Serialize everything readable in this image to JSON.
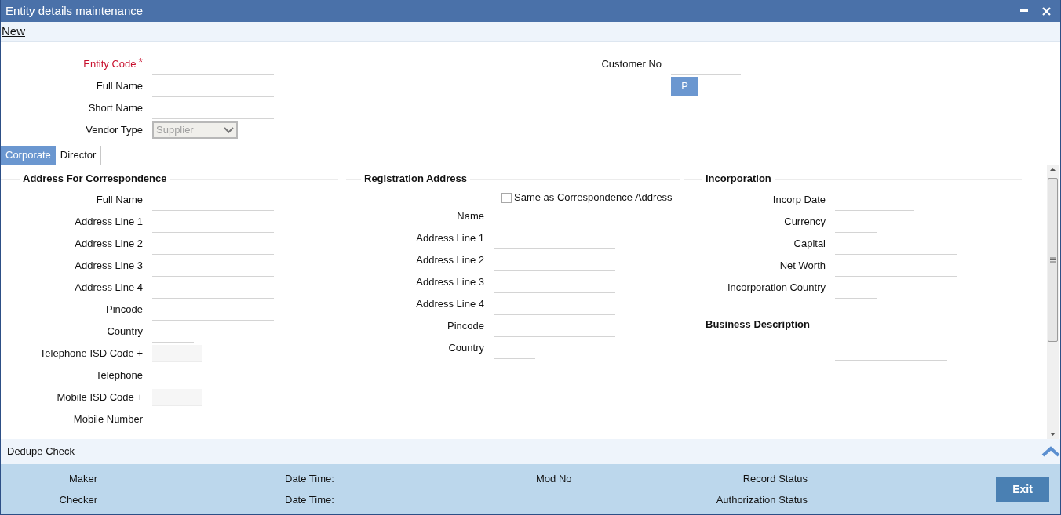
{
  "window": {
    "title": "Entity details maintenance"
  },
  "toolbar": {
    "link": "New"
  },
  "header_fields": [
    {
      "label": "Entity Code",
      "required": true,
      "required_mark": "*",
      "kind": "text"
    },
    {
      "label": "Full Name",
      "required": false,
      "kind": "text"
    },
    {
      "label": "Short Name",
      "required": false,
      "kind": "text"
    },
    {
      "label": "Vendor Type",
      "required": false,
      "kind": "select",
      "value": "Supplier",
      "disabled": true
    }
  ],
  "customer": {
    "label": "Customer No",
    "button": "P"
  },
  "tabs": [
    {
      "label": "Corporate",
      "selected": true
    },
    {
      "label": "Director",
      "selected": false
    }
  ],
  "correspondence": {
    "title": "Address For Correspondence",
    "fields": [
      {
        "label": "Full Name",
        "kind": "text"
      },
      {
        "label": "Address Line 1",
        "kind": "text"
      },
      {
        "label": "Address Line 2",
        "kind": "text"
      },
      {
        "label": "Address Line 3",
        "kind": "text"
      },
      {
        "label": "Address Line 4",
        "kind": "text"
      },
      {
        "label": "Pincode",
        "kind": "text"
      },
      {
        "label": "Country",
        "kind": "short"
      },
      {
        "label": "Telephone ISD Code +",
        "kind": "box"
      },
      {
        "label": "Telephone",
        "kind": "text"
      },
      {
        "label": "Mobile ISD Code +",
        "kind": "box"
      },
      {
        "label": "Mobile Number",
        "kind": "text"
      }
    ]
  },
  "registration": {
    "title": "Registration Address",
    "checkbox": {
      "label": "Same as Correspondence Address",
      "checked": false
    },
    "fields": [
      {
        "label": "Name",
        "kind": "text"
      },
      {
        "label": "Address Line 1",
        "kind": "text"
      },
      {
        "label": "Address Line 2",
        "kind": "text"
      },
      {
        "label": "Address Line 3",
        "kind": "text"
      },
      {
        "label": "Address Line 4",
        "kind": "text"
      },
      {
        "label": "Pincode",
        "kind": "text"
      },
      {
        "label": "Country",
        "kind": "short"
      }
    ]
  },
  "incorporation": {
    "title": "Incorporation",
    "fields": [
      {
        "label": "Incorp Date",
        "kind": "medium"
      },
      {
        "label": "Currency",
        "kind": "short"
      },
      {
        "label": "Capital",
        "kind": "text"
      },
      {
        "label": "Net Worth",
        "kind": "text"
      },
      {
        "label": "Incorporation Country",
        "kind": "short"
      }
    ]
  },
  "business": {
    "title": "Business Description"
  },
  "dedupe": {
    "label": "Dedupe Check"
  },
  "audit": [
    {
      "label": "Maker",
      "date": "Date Time:",
      "mid": "Mod No",
      "status": "Record Status"
    },
    {
      "label": "Checker",
      "date": "Date Time:",
      "status": "Authorization Status"
    }
  ],
  "exit_button": "Exit"
}
